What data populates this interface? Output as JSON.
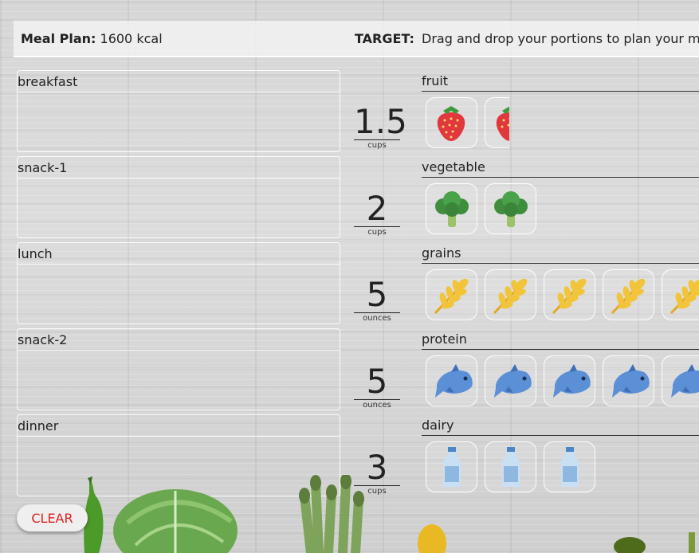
{
  "header": {
    "meal_plan_label": "Meal Plan:",
    "meal_plan_value": "1600 kcal",
    "target_label": "TARGET:",
    "instruction": "Drag and drop your portions to plan your meals"
  },
  "meals": [
    {
      "label": "breakfast"
    },
    {
      "label": "snack-1"
    },
    {
      "label": "lunch"
    },
    {
      "label": "snack-2"
    },
    {
      "label": "dinner"
    }
  ],
  "food_groups": [
    {
      "label": "fruit",
      "amount": "1.5",
      "unit": "cups",
      "token_icon": "strawberry-icon",
      "token_count": 2,
      "last_token_partial": true
    },
    {
      "label": "vegetable",
      "amount": "2",
      "unit": "cups",
      "token_icon": "broccoli-icon",
      "token_count": 2
    },
    {
      "label": "grains",
      "amount": "5",
      "unit": "ounces",
      "token_icon": "wheat-icon",
      "token_count": 5
    },
    {
      "label": "protein",
      "amount": "5",
      "unit": "ounces",
      "token_icon": "fish-icon",
      "token_count": 5
    },
    {
      "label": "dairy",
      "amount": "3",
      "unit": "cups",
      "token_icon": "milk-bottle-icon",
      "token_count": 3
    }
  ],
  "clear_button": {
    "label": "CLEAR"
  },
  "colors": {
    "clear_text": "#e02020",
    "background": "#d8d8d8"
  }
}
